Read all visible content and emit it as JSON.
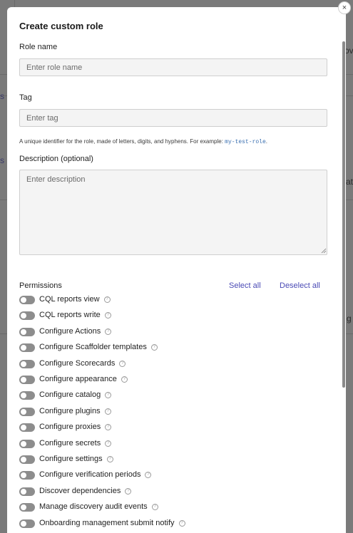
{
  "modal": {
    "title": "Create custom role",
    "close_label": "×",
    "role_name": {
      "label": "Role name",
      "placeholder": "Enter role name",
      "value": ""
    },
    "tag": {
      "label": "Tag",
      "placeholder": "Enter tag",
      "value": ""
    },
    "tag_help": {
      "text": "A unique identifier for the role, made of letters, digits, and hyphens. For example: ",
      "example": "my-test-role",
      "suffix": "."
    },
    "description": {
      "label": "Description (optional)",
      "placeholder": "Enter description",
      "value": ""
    },
    "permissions": {
      "heading": "Permissions",
      "select_all": "Select all",
      "deselect_all": "Deselect all",
      "items": [
        {
          "label": "CQL reports view",
          "enabled": false
        },
        {
          "label": "CQL reports write",
          "enabled": false
        },
        {
          "label": "Configure Actions",
          "enabled": false
        },
        {
          "label": "Configure Scaffolder templates",
          "enabled": false
        },
        {
          "label": "Configure Scorecards",
          "enabled": false
        },
        {
          "label": "Configure appearance",
          "enabled": false
        },
        {
          "label": "Configure catalog",
          "enabled": false
        },
        {
          "label": "Configure plugins",
          "enabled": false
        },
        {
          "label": "Configure proxies",
          "enabled": false
        },
        {
          "label": "Configure secrets",
          "enabled": false
        },
        {
          "label": "Configure settings",
          "enabled": false
        },
        {
          "label": "Configure verification periods",
          "enabled": false
        },
        {
          "label": "Discover dependencies",
          "enabled": false
        },
        {
          "label": "Manage discovery audit events",
          "enabled": false
        },
        {
          "label": "Onboarding management submit notify",
          "enabled": false
        }
      ]
    }
  },
  "icons": {
    "help": "question-circle-icon",
    "close": "close-icon"
  },
  "background_fragments": [
    "ov",
    "s",
    "s",
    "at",
    "g"
  ],
  "colors": {
    "link": "#4a4ab5",
    "code": "#3a6fb0",
    "toggle_off": "#8d8d8d",
    "overlay": "#7a7a7a"
  }
}
